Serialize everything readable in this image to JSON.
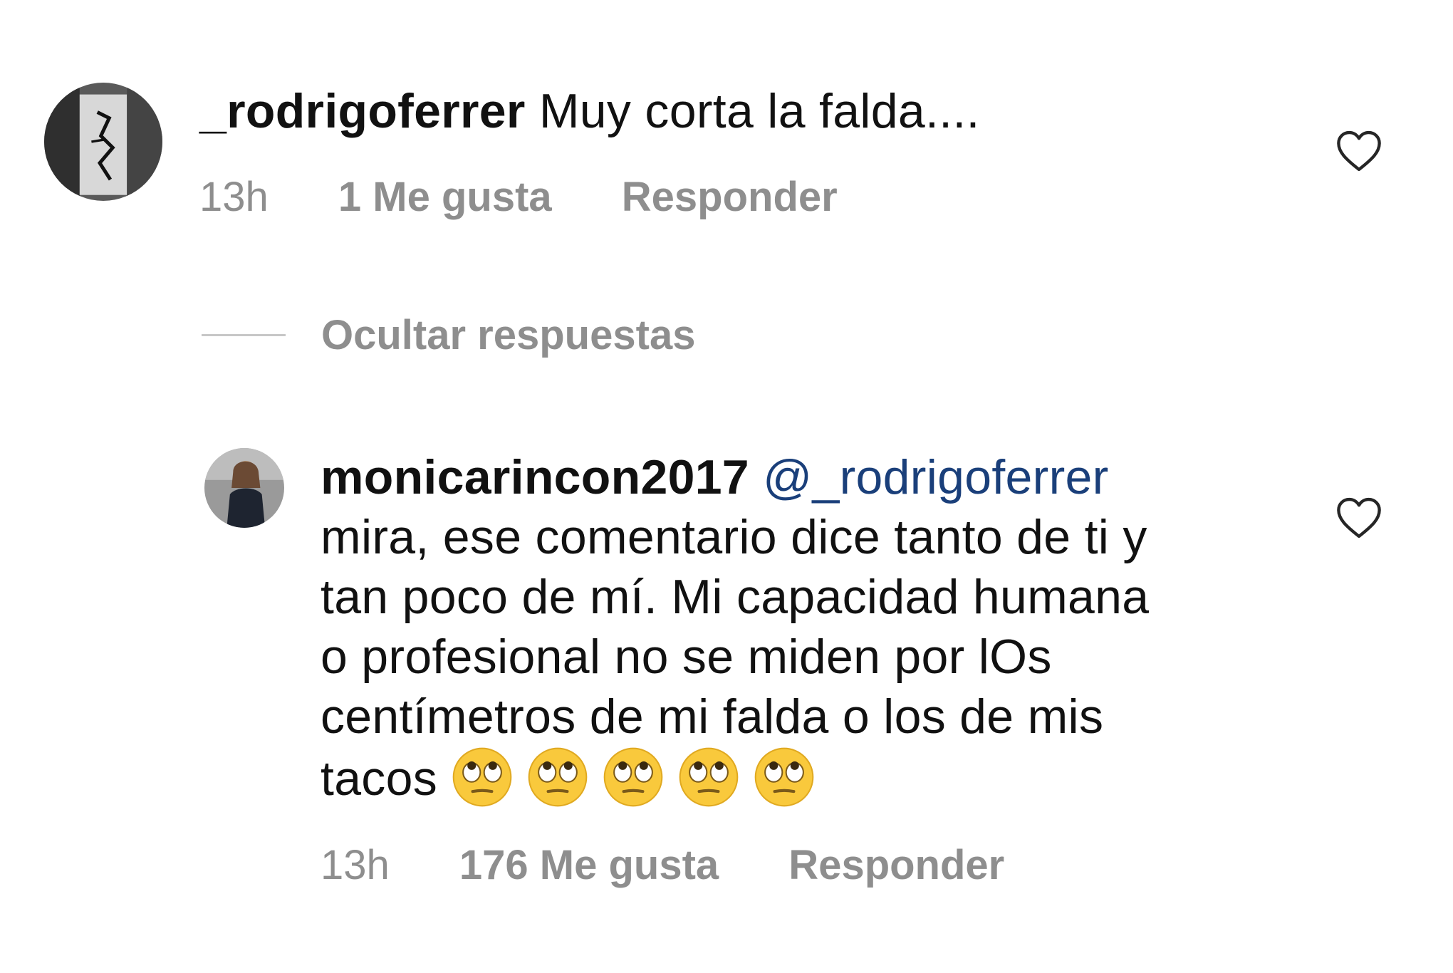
{
  "comments": [
    {
      "username": "_rodrigoferrer",
      "text": "Muy corta la falda....",
      "time": "13h",
      "likes": "1 Me gusta",
      "reply": "Responder"
    },
    {
      "username": "monicarincon2017",
      "mention": "@_rodrigoferrer",
      "lines": [
        "mira, ese comentario dice tanto de ti y",
        "tan poco de mí. Mi capacidad humana",
        "o profesional no se miden por lOs",
        "centímetros de mi falda o los de mis",
        "tacos"
      ],
      "emoji_count": 5,
      "emoji_icon": "face-with-rolling-eyes",
      "time": "13h",
      "likes": "176 Me gusta",
      "reply": "Responder"
    }
  ],
  "hide_replies": "Ocultar respuestas",
  "icons": {
    "like": "heart-outline-icon"
  },
  "colors": {
    "mention": "#1a3f7a",
    "meta": "#8e8e8e",
    "text": "#111111"
  }
}
